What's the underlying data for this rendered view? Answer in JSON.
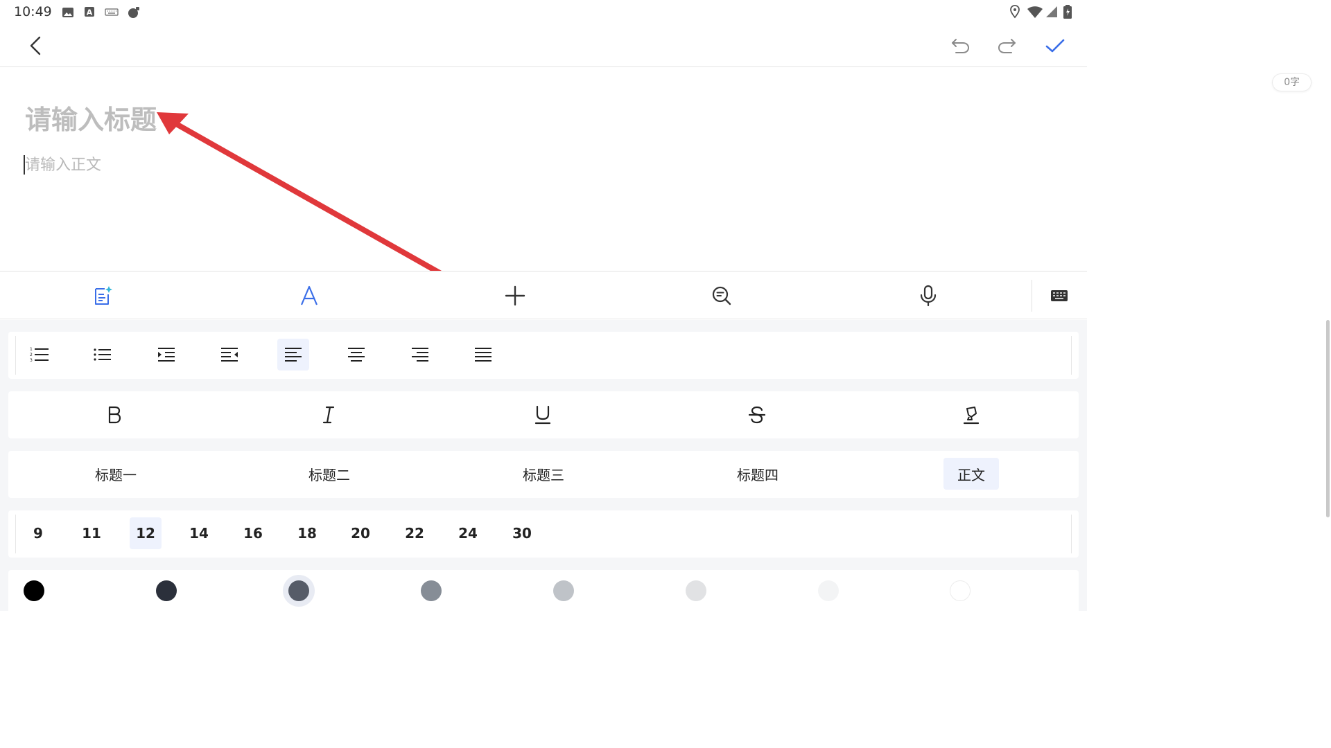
{
  "status_bar": {
    "time": "10:49",
    "left_icons": [
      "image-icon",
      "font-a-icon",
      "keyboard-icon",
      "bug-icon"
    ],
    "right_icons": [
      "location-icon",
      "wifi-icon",
      "signal-icon",
      "battery-icon"
    ]
  },
  "header": {
    "back_icon": "chevron-left-icon",
    "undo_icon": "undo-icon",
    "redo_icon": "redo-icon",
    "confirm_icon": "check-icon",
    "accent_color": "#3a6ee8"
  },
  "editor": {
    "word_count": "0字",
    "title_placeholder": "请输入标题",
    "body_placeholder": "请输入正文"
  },
  "toolbar": {
    "items": [
      "ai-note-icon",
      "text-format-icon",
      "add-icon",
      "search-icon",
      "microphone-icon",
      "keyboard-icon"
    ],
    "active_item": "text-format-icon"
  },
  "format_panel": {
    "paragraph_tools": [
      "ordered-list-icon",
      "bullet-list-icon",
      "indent-icon",
      "outdent-icon",
      "align-left-icon",
      "align-center-icon",
      "align-right-icon",
      "align-justify-icon"
    ],
    "selected_alignment": "align-left-icon",
    "text_styles": [
      "bold-icon",
      "italic-icon",
      "underline-icon",
      "strikethrough-icon",
      "highlight-icon"
    ],
    "headings": [
      "标题一",
      "标题二",
      "标题三",
      "标题四",
      "正文"
    ],
    "selected_heading": "正文",
    "font_sizes": [
      "9",
      "11",
      "12",
      "14",
      "16",
      "18",
      "20",
      "22",
      "24",
      "30"
    ],
    "selected_font_size": "12",
    "colors": [
      "#000000",
      "#2b303b",
      "#565c68",
      "#868d96",
      "#bfc3c8",
      "#e1e2e4",
      "#f3f4f5",
      "#ffffff"
    ],
    "selected_color": "#565c68"
  }
}
